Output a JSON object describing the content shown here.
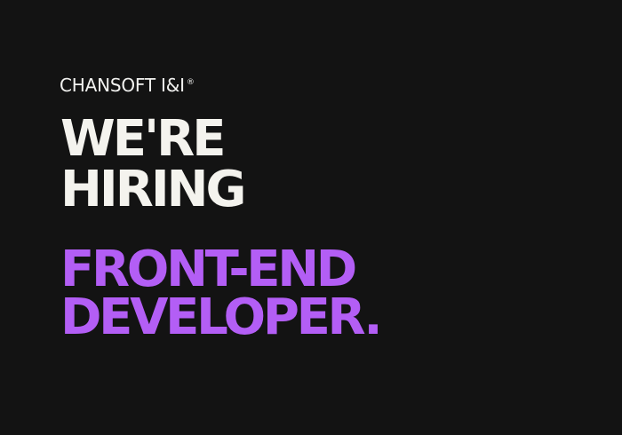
{
  "brand": {
    "name": "CHANSOFT I&I",
    "mark": "®"
  },
  "headline": {
    "line1": "WE'RE",
    "line2": "HIRING"
  },
  "role": {
    "line1": "FRONT-END",
    "line2": "DEVELOPER."
  },
  "colors": {
    "background": "#131313",
    "text": "#f4f3ee",
    "accent": "#b35ef5"
  }
}
